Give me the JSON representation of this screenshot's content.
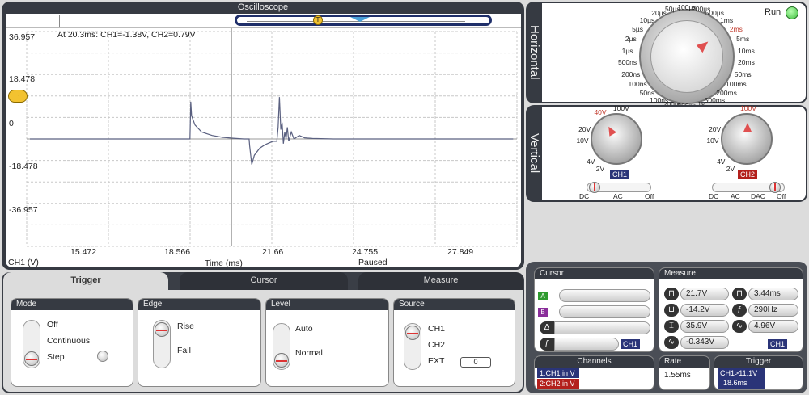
{
  "scope": {
    "title": "Oscilloscope",
    "readout": "At 20.3ms: CH1=-1.38V, CH2=0.79V",
    "y_ticks": [
      "36.957",
      "18.478",
      "0",
      "-18.478",
      "-36.957"
    ],
    "x_ticks": [
      "15.472",
      "18.566",
      "21.66",
      "24.755",
      "27.849"
    ],
    "y_label": "CH1 (V)",
    "x_label": "Time (ms)",
    "status": "Paused",
    "marker_icon": "trigger-marker-icon",
    "level_icon": "trigger-level-icon"
  },
  "chart_data": {
    "type": "line",
    "xlabel": "Time (ms)",
    "ylabel": "CH1 (V)",
    "xlim": [
      12.378,
      30.943
    ],
    "ylim": [
      -46.2,
      46.2
    ],
    "grid": true,
    "series": [
      {
        "x": [
          12.5,
          18.1,
          18.56,
          18.59,
          18.62,
          18.75,
          19.0,
          19.4,
          19.8,
          20.2,
          20.6,
          20.8,
          20.82,
          20.9,
          21.0,
          21.2,
          21.4,
          21.7,
          21.85,
          21.9,
          21.95,
          22.0,
          22.05,
          22.1,
          22.15,
          22.2,
          22.25,
          22.3,
          22.4,
          22.5,
          22.7,
          22.9,
          23.2,
          24.0,
          26.0,
          30.8
        ],
        "y": [
          0,
          0,
          0,
          16,
          10,
          6,
          3,
          1.5,
          0.7,
          0.3,
          0,
          0,
          -3,
          -11,
          -7,
          -4,
          -2.5,
          -1,
          -1,
          5,
          18,
          4,
          7,
          -2,
          3,
          0,
          5,
          -1,
          3,
          0,
          1.5,
          0.5,
          0.2,
          0,
          0,
          0
        ]
      }
    ]
  },
  "horizontal": {
    "title": "Horizontal",
    "run_label": "Run",
    "labels": [
      "100µs",
      "200µs",
      "500µs",
      "1ms",
      "2ms",
      "5ms",
      "10ms",
      "20ms",
      "50ms",
      "100ms",
      "200ms",
      "500ms",
      "1s",
      "500ns",
      "200ns",
      "100ns",
      "50ns",
      "100ns",
      "200ns",
      "500ns",
      "1µs",
      "2µs",
      "5µs",
      "10µs",
      "20µs",
      "50µs"
    ]
  },
  "vertical": {
    "title": "Vertical",
    "ch1": {
      "name": "CH1",
      "labels": [
        "40V",
        "100V",
        "20V",
        "10V",
        "4V",
        "2V"
      ],
      "coupling": [
        "DC",
        "AC",
        "Off"
      ]
    },
    "ch2": {
      "name": "CH2",
      "labels": [
        "100V",
        "20V",
        "10V",
        "4V",
        "2V"
      ],
      "coupling": [
        "DC",
        "AC",
        "DAC",
        "Off"
      ]
    }
  },
  "tabs": {
    "trigger": "Trigger",
    "cursor": "Cursor",
    "measure": "Measure"
  },
  "trigger": {
    "mode": {
      "title": "Mode",
      "options": [
        "Off",
        "Continuous",
        "Step"
      ]
    },
    "edge": {
      "title": "Edge",
      "options": [
        "Rise",
        "Fall"
      ]
    },
    "level": {
      "title": "Level",
      "options": [
        "Auto",
        "Normal"
      ]
    },
    "source": {
      "title": "Source",
      "options": [
        "CH1",
        "CH2",
        "EXT"
      ],
      "ext_value": "0"
    }
  },
  "cursor": {
    "title": "Cursor",
    "a": "A",
    "b": "B",
    "delta": "Δ",
    "f": "ƒ",
    "channel": "CH1"
  },
  "measure": {
    "title": "Measure",
    "values": [
      "21.7V",
      "3.44ms",
      "-14.2V",
      "290Hz",
      "35.9V",
      "4.96V",
      "-0.343V"
    ],
    "channel": "CH1"
  },
  "channels": {
    "title": "Channels",
    "items": [
      "1:CH1 in V",
      "2:CH2 in V"
    ]
  },
  "rate": {
    "title": "Rate",
    "value": "1.55ms"
  },
  "trigger_status": {
    "title": "Trigger",
    "line1": "CH1>11.1V",
    "line2": "18.6ms"
  },
  "colors": {
    "ch1": "#2a3478",
    "ch2": "#b3201c",
    "panel": "#363a42",
    "trace": "#5a6080",
    "run": "#3fbf3f"
  }
}
